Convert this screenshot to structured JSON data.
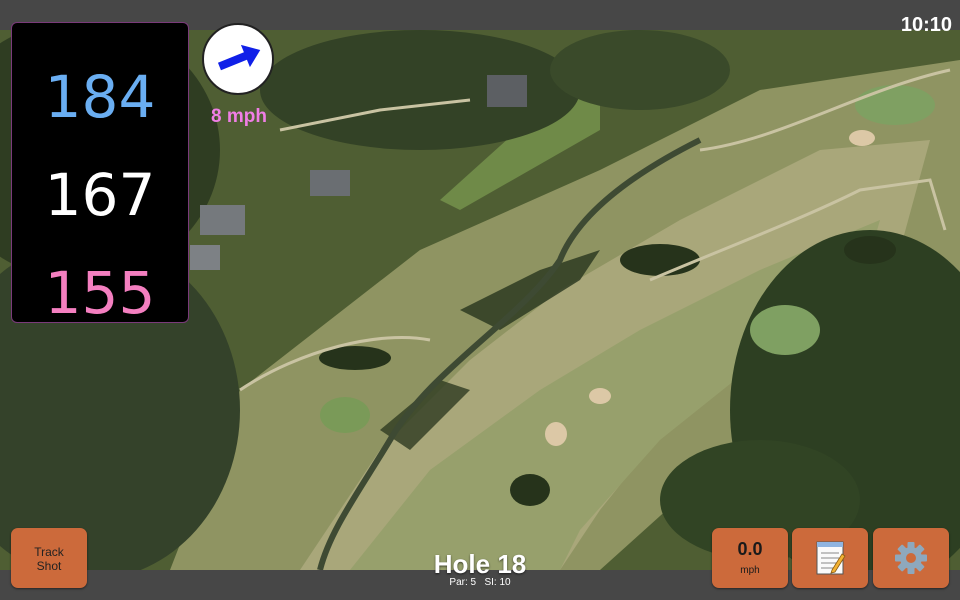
{
  "status": {
    "time": "10:10"
  },
  "distances": {
    "back": "184",
    "middle": "167",
    "front": "155"
  },
  "wind": {
    "speed_text": "8 mph",
    "direction_icon": "arrow-up-right-icon",
    "arrow_color": "#1020e8"
  },
  "buttons": {
    "track_shot": {
      "line1": "Track",
      "line2": "Shot"
    },
    "speed": {
      "value": "0.0",
      "unit": "mph"
    },
    "notes_icon": "notepad-icon",
    "settings_icon": "gear-icon"
  },
  "hole": {
    "title": "Hole 18",
    "par": "Par: 5",
    "si": "SI: 10"
  },
  "colors": {
    "back": "#6aaef2",
    "middle": "#ffffff",
    "front": "#f47fc0",
    "button": "#cc6a3b",
    "wind_text": "#f07ee6"
  }
}
